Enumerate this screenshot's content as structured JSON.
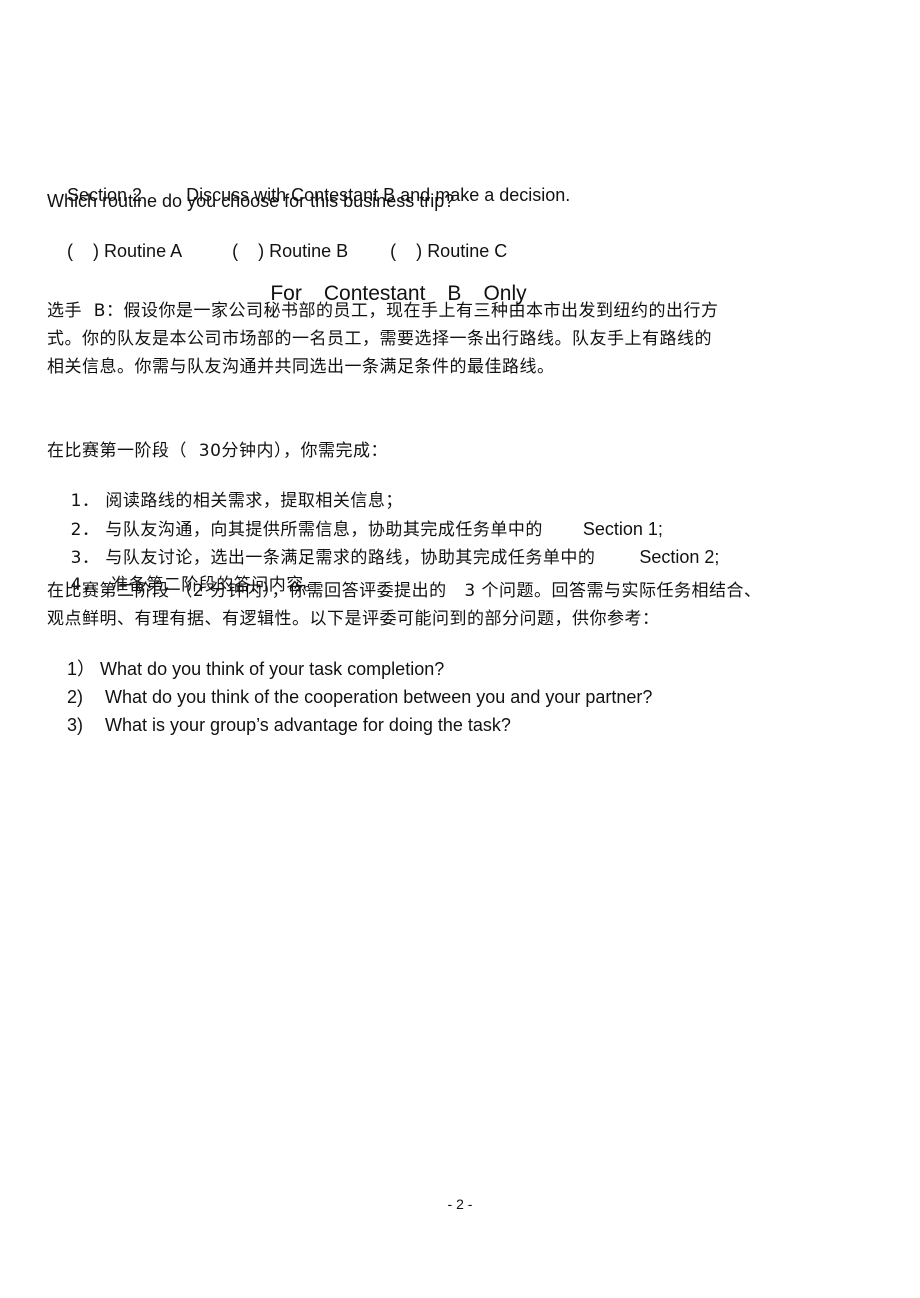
{
  "section2": {
    "label": "Section 2",
    "instruction": "Discuss with Contestant B and make a decision.",
    "question": "Which routine do you choose for this business trip?",
    "options": [
      {
        "bracket": "(    )",
        "label": "Routine A"
      },
      {
        "bracket": "(    )",
        "label": "Routine B"
      },
      {
        "bracket": "(    )",
        "label": "Routine C"
      }
    ]
  },
  "heading": {
    "words": [
      "For",
      "Contestant",
      "B",
      "Only"
    ]
  },
  "intro": {
    "lines": [
      "选手  B：假设你是一家公司秘书部的员工，现在手上有三种由本市出发到纽约的出行方",
      "式。你的队友是本公司市场部的一名员工，需要选择一条出行路线。队友手上有路线的",
      "相关信息。你需与队友沟通并共同选出一条满足条件的最佳路线。"
    ]
  },
  "stage1": {
    "heading": "在比赛第一阶段（  30分钟内），你需完成：",
    "items": [
      {
        "num": "1．",
        "text": "阅读路线的相关需求，提取相关信息；",
        "tail": ""
      },
      {
        "num": "2．",
        "text": "与队友沟通，向其提供所需信息，协助其完成任务单中的",
        "tail": "Section 1;"
      },
      {
        "num": "3．",
        "text": "与队友讨论，选出一条满足需求的路线，协助其完成任务单中的",
        "tail": "Section 2;"
      },
      {
        "num": "4．",
        "text": " 准备第二阶段的答问内容。",
        "tail": ""
      }
    ]
  },
  "stage2": {
    "lines": [
      "在比赛第二阶段 （2 分钟内），你需回答评委提出的   3 个问题。回答需与实际任务相结合、",
      "观点鲜明、有理有据、有逻辑性。以下是评委可能问到的部分问题，供你参考："
    ],
    "questions": [
      {
        "num": "1）",
        "text": "What do you think of your task completion?"
      },
      {
        "num": "2)",
        "text": "What do you think of the cooperation between you and your partner?"
      },
      {
        "num": "3)",
        "text": "What is your group’s advantage for doing the task?"
      }
    ]
  },
  "footer": {
    "page_number": "- 2 -"
  }
}
